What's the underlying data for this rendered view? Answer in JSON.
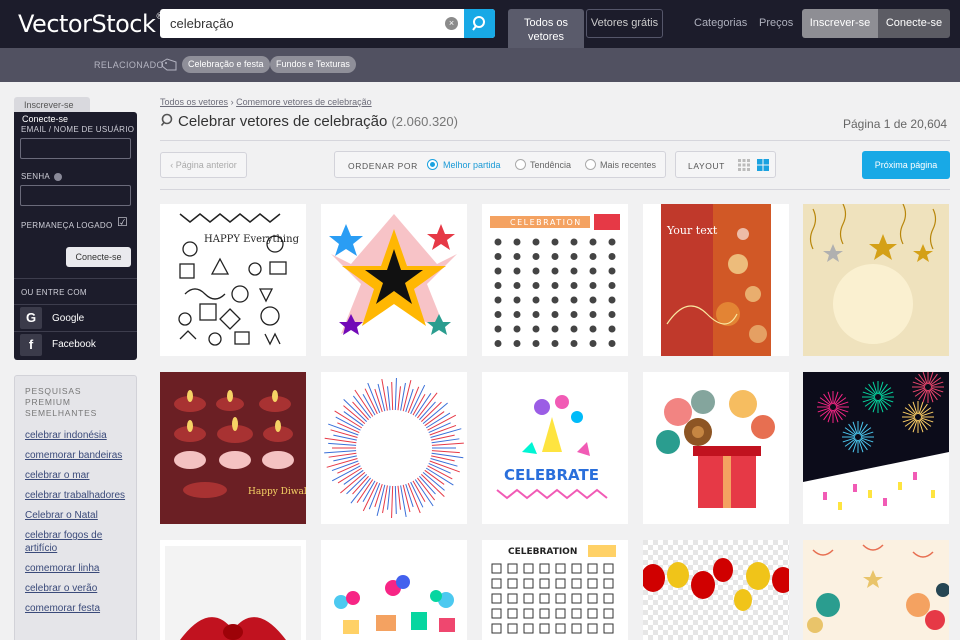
{
  "header": {
    "logo": "VectorStock",
    "logo_mark": "®",
    "search_value": "celebração",
    "clear_glyph": "×",
    "tab_all": "Todos os vetores",
    "tab_free": "Vetores grátis",
    "nav_categories": "Categorias",
    "nav_prices": "Preços",
    "signup": "Inscrever-se",
    "login": "Conecte-se"
  },
  "related": {
    "label": "RELACIONADO",
    "tags": [
      "Celebração e festa",
      "Fundos e Texturas"
    ]
  },
  "sidebar": {
    "tab_signup": "Inscrever-se",
    "tab_login": "Conecte-se",
    "email_label": "EMAIL / NOME DE USUÁRIO",
    "password_label": "SENHA",
    "remember_label": "PERMANEÇA LOGADO",
    "check_glyph": "☑",
    "login_button": "Conecte-se",
    "or_label": "OU ENTRE COM",
    "google": "Google",
    "google_glyph": "G",
    "facebook": "Facebook",
    "facebook_glyph": "f"
  },
  "premium": {
    "title": "PESQUISAS PREMIUM SEMELHANTES",
    "items": [
      "celebrar indonésia",
      "comemorar bandeiras",
      "celebrar o mar",
      "celebrar trabalhadores",
      "Celebrar o Natal",
      "celebrar fogos de artifício",
      "comemorar linha",
      "celebrar o verão",
      "comemorar festa"
    ]
  },
  "main": {
    "breadcrumb_home": "Todos os vetores",
    "breadcrumb_sep": "›",
    "breadcrumb_current": "Comemore vetores de celebração",
    "title": "Celebrar vetores de celebração",
    "count": "(2.060.320)",
    "page_info": "Página 1 de 20,604",
    "prev_button": "‹ Página anterior",
    "sort_label": "ORDENAR POR",
    "sort_options": [
      "Melhor partida",
      "Tendência",
      "Mais recentes"
    ],
    "sort_selected": "Melhor partida",
    "layout_label": "LAYOUT",
    "next_button": "Próxima página"
  },
  "thumbs": {
    "celebration_label": "CELEBRATION",
    "celebration_label2": "CELEBRATION",
    "your_text": "Your text",
    "happy_diwali": "Happy Diwali",
    "celebrate": "CELEBRATE",
    "happy_everything": "HAPPY Everything"
  },
  "colors": {
    "accent": "#18a9e6",
    "topbar": "#1c1c2b",
    "related_bar": "#515161"
  }
}
